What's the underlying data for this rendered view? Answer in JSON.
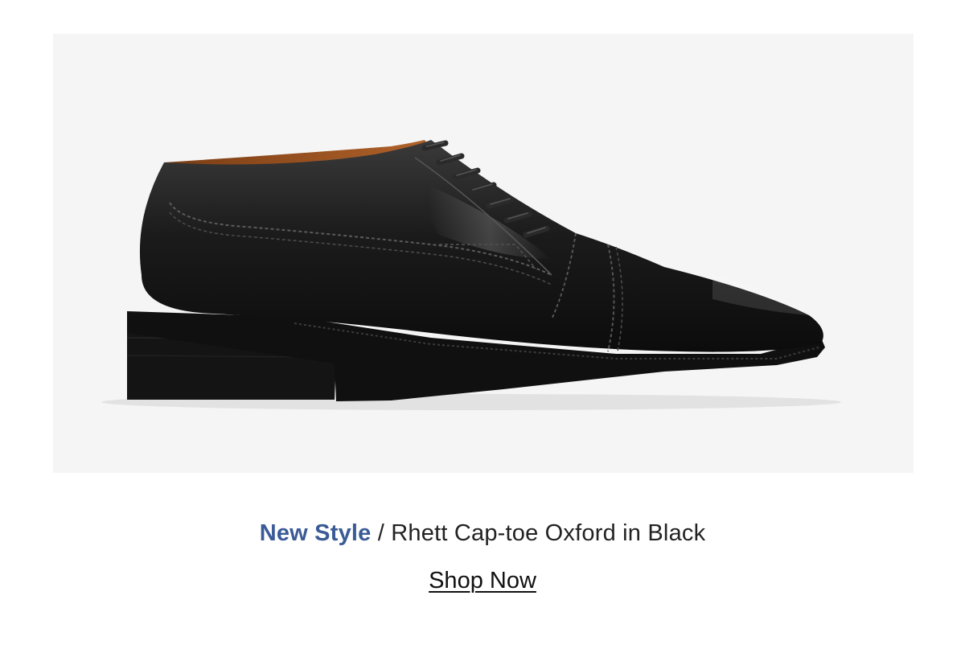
{
  "product": {
    "image_alt": "Rhett Cap-toe Oxford in Black",
    "tag_label": "New Style",
    "separator": " / ",
    "name": "Rhett Cap-toe Oxford in Black"
  },
  "cta": {
    "label": "Shop Now"
  },
  "colors": {
    "tag": "#3b5b96",
    "text": "#222222",
    "image_background": "#f5f5f5",
    "shoe": "#1a1a1a"
  }
}
